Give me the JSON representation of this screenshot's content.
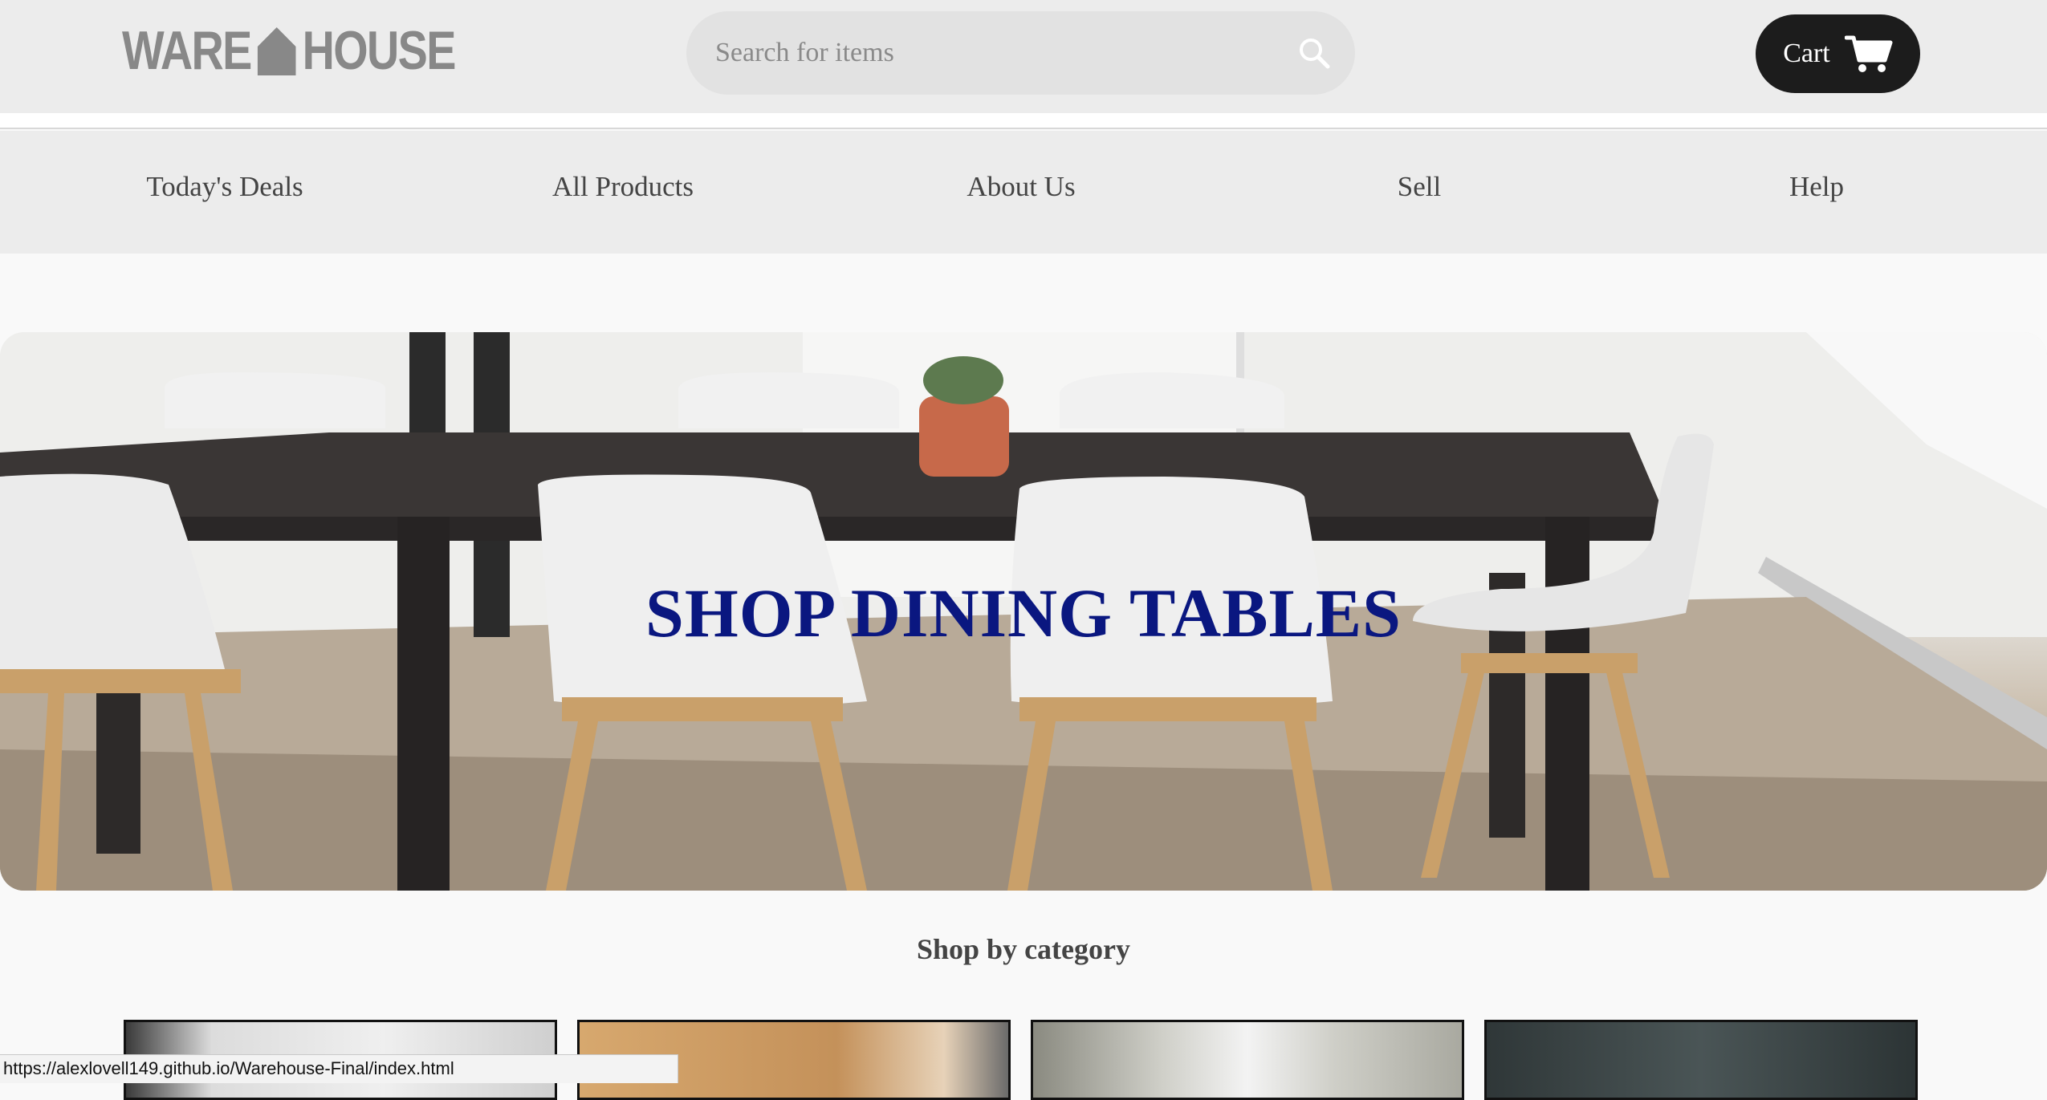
{
  "header": {
    "logo_left": "WARE",
    "logo_right": "HOUSE",
    "search_placeholder": "Search for items",
    "cart_label": "Cart"
  },
  "nav": {
    "items": [
      {
        "label": "Today's Deals"
      },
      {
        "label": "All Products"
      },
      {
        "label": "About Us"
      },
      {
        "label": "Sell"
      },
      {
        "label": "Help"
      }
    ]
  },
  "hero": {
    "title": "SHOP DINING TABLES",
    "title_color": "#0a1780"
  },
  "categories": {
    "heading": "Shop by category"
  },
  "status_bar": {
    "url": "https://alexlovell149.github.io/Warehouse-Final/index.html"
  },
  "icons": {
    "search": "search-icon",
    "cart": "cart-icon",
    "logo": "house-icon"
  },
  "colors": {
    "header_bg": "#ececec",
    "cart_bg": "#1c1c1c",
    "page_bg": "#f9f9f9"
  }
}
